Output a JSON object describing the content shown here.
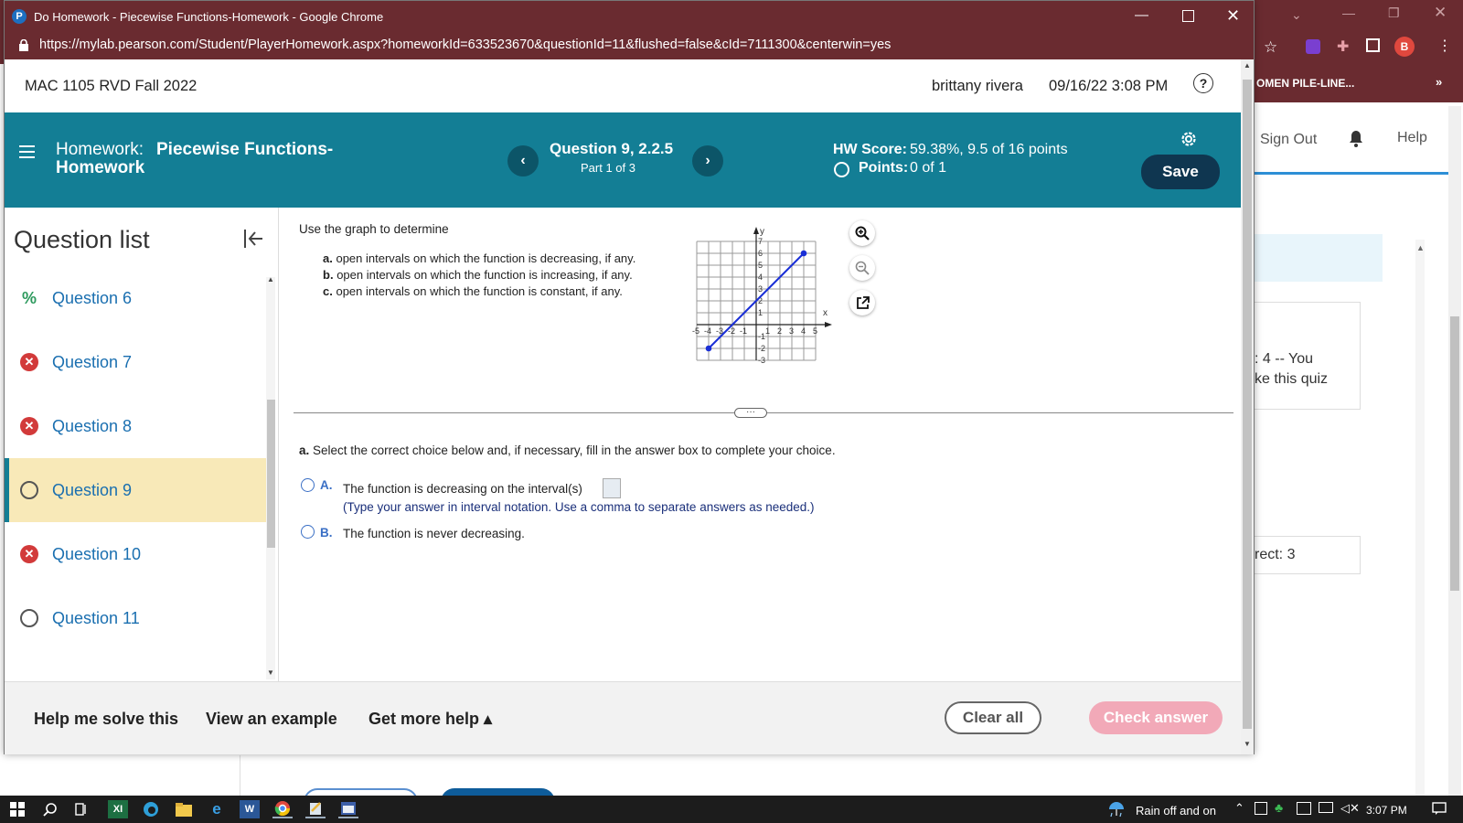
{
  "window": {
    "title": "Do Homework - Piecewise Functions-Homework - Google Chrome",
    "url": "https://mylab.pearson.com/Student/PlayerHomework.aspx?homeworkId=633523670&questionId=11&flushed=false&cId=7111300&centerwin=yes"
  },
  "background": {
    "bookmark_text": "OMEN PILE-LINE...",
    "sign_out": "Sign Out",
    "help": "Help",
    "card1_line1": ": 4 -- You",
    "card1_line2": "ke this quiz",
    "card2": "rect: 3",
    "profile_initial": "B"
  },
  "course": {
    "name": "MAC 1105 RVD Fall 2022",
    "user": "brittany rivera",
    "datetime": "09/16/22 3:08 PM"
  },
  "header": {
    "homework_prefix": "Homework:",
    "homework_title_line1": "Piecewise Functions-",
    "homework_title_line2": "Homework",
    "question_label": "Question 9, 2.2.5",
    "part_label": "Part 1 of 3",
    "hw_score_label": "HW Score:",
    "hw_score_value": "59.38%, 9.5 of 16 points",
    "points_label": "Points:",
    "points_value": "0 of 1",
    "save_label": "Save"
  },
  "question_list": {
    "title": "Question list",
    "items": [
      {
        "label": "Question 6",
        "status": "partial"
      },
      {
        "label": "Question 7",
        "status": "incorrect"
      },
      {
        "label": "Question 8",
        "status": "incorrect"
      },
      {
        "label": "Question 9",
        "status": "current"
      },
      {
        "label": "Question 10",
        "status": "incorrect"
      },
      {
        "label": "Question 11",
        "status": "unanswered"
      }
    ]
  },
  "problem": {
    "intro": "Use the graph to determine",
    "a_label": "a.",
    "a_text": "open intervals on which the function is decreasing, if any.",
    "b_label": "b.",
    "b_text": "open intervals on which the function is increasing, if any.",
    "c_label": "c.",
    "c_text": "open intervals on which the function is constant, if any.",
    "divider_handle": "···",
    "instruction_label": "a.",
    "instruction_text": "Select the correct choice below and, if necessary, fill in the answer box to complete your choice.",
    "choice_a_label": "A.",
    "choice_a_text": "The function is decreasing on the interval(s)",
    "choice_a_hint": "(Type your answer in interval notation. Use a comma to separate answers as needed.)",
    "choice_b_label": "B.",
    "choice_b_text": "The function is never decreasing."
  },
  "graph": {
    "x_axis_label": "x",
    "y_axis_label": "y",
    "x_ticks": [
      "-5",
      "-4",
      "-3",
      "-2",
      "-1",
      "1",
      "2",
      "3",
      "4",
      "5"
    ],
    "y_ticks": [
      "7",
      "6",
      "5",
      "4",
      "3",
      "2",
      "1",
      "-1",
      "-2",
      "-3"
    ],
    "segment": {
      "from": [
        -4,
        -2
      ],
      "to": [
        4,
        6
      ]
    },
    "line_color": "#1a2fd6"
  },
  "bottom": {
    "help_solve": "Help me solve this",
    "view_example": "View an example",
    "more_help": "Get more help ▴",
    "clear_all": "Clear all",
    "check_answer": "Check answer"
  },
  "taskbar": {
    "weather": "Rain off and on",
    "clock": "3:07 PM"
  },
  "colors": {
    "chrome_frame": "#6a2b30",
    "header_teal": "#137e95",
    "save_button": "#0f3650",
    "link_blue": "#1a6fb0",
    "current_highlight": "#f8e9b8",
    "check_answer": "#f2a9b8"
  }
}
